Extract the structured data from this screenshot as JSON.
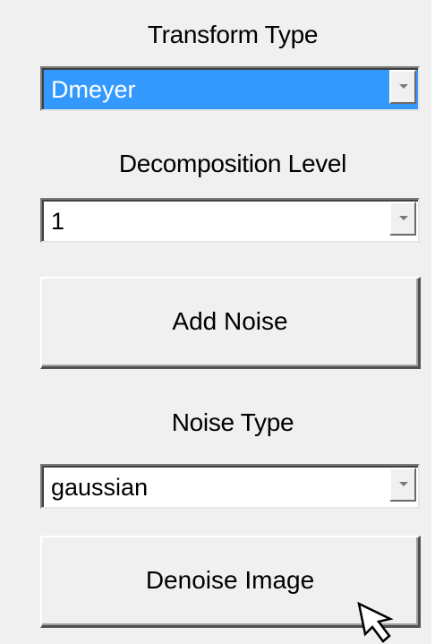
{
  "transform": {
    "label": "Transform Type",
    "selected_value": "Dmeyer"
  },
  "decomposition": {
    "label": "Decomposition Level",
    "selected_value": "1"
  },
  "add_noise_button": {
    "label": "Add Noise"
  },
  "noise": {
    "label": "Noise Type",
    "selected_value": "gaussian"
  },
  "denoise_button": {
    "label": "Denoise Image"
  },
  "colors": {
    "panel_background": "#f0f0f0",
    "selection_highlight": "#3399ff"
  },
  "icons": {
    "dropdown_arrow": "chevron-down-icon",
    "cursor": "mouse-pointer-icon"
  }
}
